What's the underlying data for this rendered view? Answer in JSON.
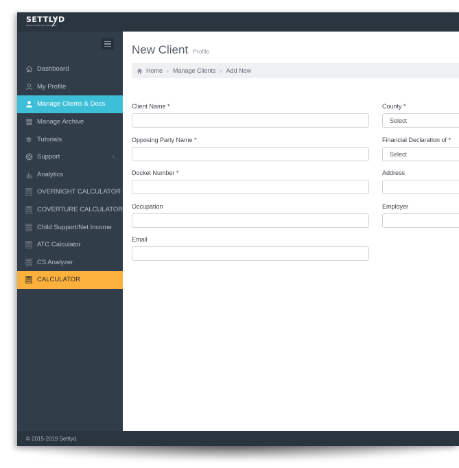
{
  "brand": {
    "name": "SETTLYD",
    "tagline": "Settled Business Solutions"
  },
  "sidebar": {
    "items": [
      {
        "label": "Dashboard",
        "icon": "home-icon",
        "state": "normal"
      },
      {
        "label": "My Profile",
        "icon": "user-icon",
        "state": "normal"
      },
      {
        "label": "Manage Clients & Docs",
        "icon": "user-solid-icon",
        "state": "active"
      },
      {
        "label": "Manage Archive",
        "icon": "archive-icon",
        "state": "normal"
      },
      {
        "label": "Tutorials",
        "icon": "graduation-cap-icon",
        "state": "normal"
      },
      {
        "label": "Support",
        "icon": "life-ring-icon",
        "state": "normal",
        "chevron": "‹"
      },
      {
        "label": "Analytics",
        "icon": "bar-chart-icon",
        "state": "normal"
      },
      {
        "label": "OVERNIGHT CALCULATOR",
        "icon": "calculator-icon",
        "state": "normal"
      },
      {
        "label": "COVERTURE CALCULATOR",
        "icon": "calculator-icon",
        "state": "normal"
      },
      {
        "label": "Child Support/Net Income",
        "icon": "calculator-icon",
        "state": "normal"
      },
      {
        "label": "ATC Calculator",
        "icon": "calculator-icon",
        "state": "normal"
      },
      {
        "label": "CS Analyzer",
        "icon": "calculator-icon",
        "state": "normal"
      },
      {
        "label": "CALCULATOR",
        "icon": "calculator-icon",
        "state": "highlight"
      }
    ]
  },
  "page": {
    "title": "New Client",
    "subtitle": "Profile"
  },
  "breadcrumb": {
    "home": "Home",
    "section": "Manage Clients",
    "current": "Add New",
    "separator": "›"
  },
  "form": {
    "client_name": {
      "label": "Client Name *",
      "value": ""
    },
    "county": {
      "label": "County *",
      "value": "Select"
    },
    "opposing_party_name": {
      "label": "Opposing Party Name *",
      "value": ""
    },
    "financial_declaration": {
      "label": "Financial Declaration of *",
      "value": "Select"
    },
    "docket_number": {
      "label": "Docket Number *",
      "value": ""
    },
    "address": {
      "label": "Address",
      "value": ""
    },
    "occupation": {
      "label": "Occupation",
      "value": ""
    },
    "employer": {
      "label": "Employer",
      "value": ""
    },
    "email": {
      "label": "Email",
      "value": ""
    }
  },
  "footer": {
    "copyright": "© 2015-2019 Settlyd."
  },
  "colors": {
    "sidebar_bg": "#323d4a",
    "topbar_bg": "#2b3540",
    "active": "#3ebfd8",
    "highlight": "#fbb13c",
    "breadcrumb_bg": "#eef0f2"
  }
}
